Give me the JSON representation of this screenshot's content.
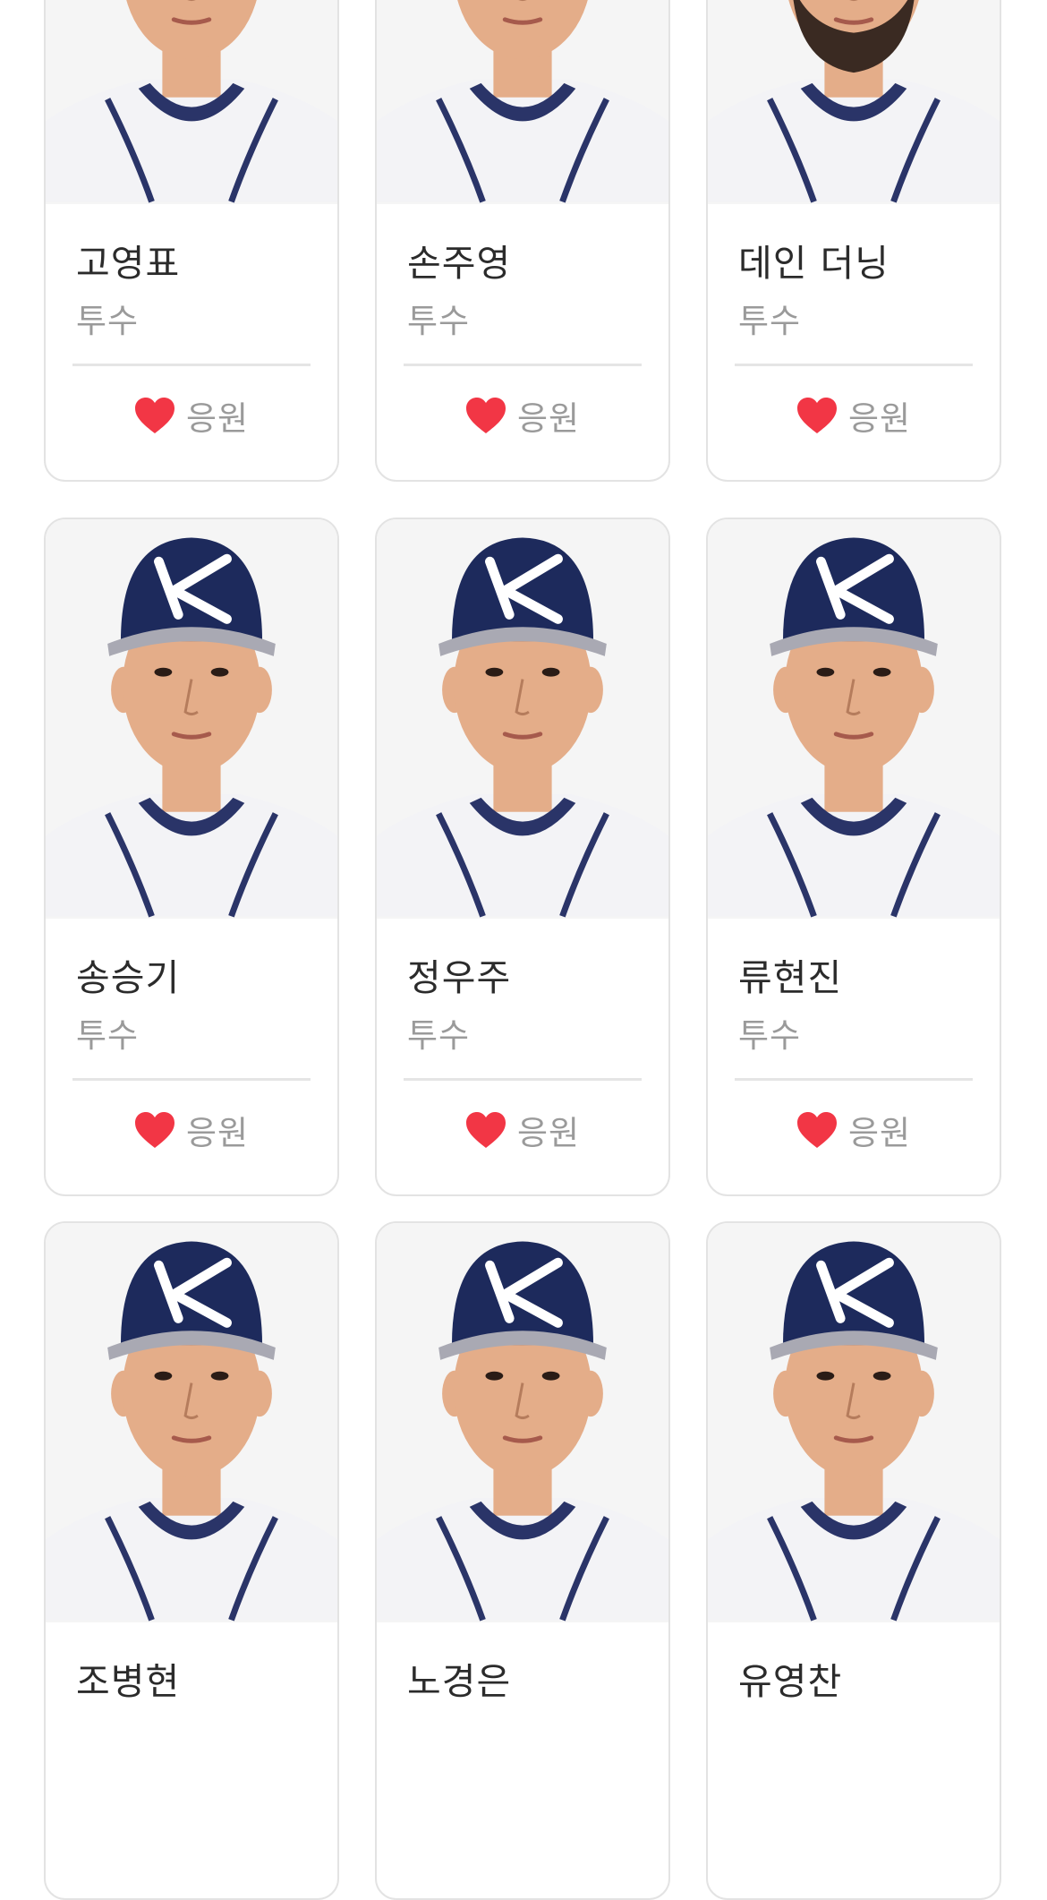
{
  "colors": {
    "heart": "#f23645",
    "cap": "#1d2a5c",
    "jersey_trim": "#2a3468",
    "skin": "#e4ad89",
    "card_border": "#e3e3e3"
  },
  "players": [
    {
      "name": "고영표",
      "position": "투수",
      "cheer_label": "응원",
      "cap": false,
      "beard": false
    },
    {
      "name": "손주영",
      "position": "투수",
      "cheer_label": "응원",
      "cap": false,
      "beard": false
    },
    {
      "name": "데인 더닝",
      "position": "투수",
      "cheer_label": "응원",
      "cap": false,
      "beard": true
    },
    {
      "name": "송승기",
      "position": "투수",
      "cheer_label": "응원",
      "cap": true,
      "beard": false
    },
    {
      "name": "정우주",
      "position": "투수",
      "cheer_label": "응원",
      "cap": true,
      "beard": false
    },
    {
      "name": "류현진",
      "position": "투수",
      "cheer_label": "응원",
      "cap": true,
      "beard": false
    },
    {
      "name": "조병현",
      "position": "",
      "cheer_label": "",
      "cap": true,
      "beard": false
    },
    {
      "name": "노경은",
      "position": "",
      "cheer_label": "",
      "cap": true,
      "beard": false
    },
    {
      "name": "유영찬",
      "position": "",
      "cheer_label": "",
      "cap": true,
      "beard": false
    }
  ]
}
